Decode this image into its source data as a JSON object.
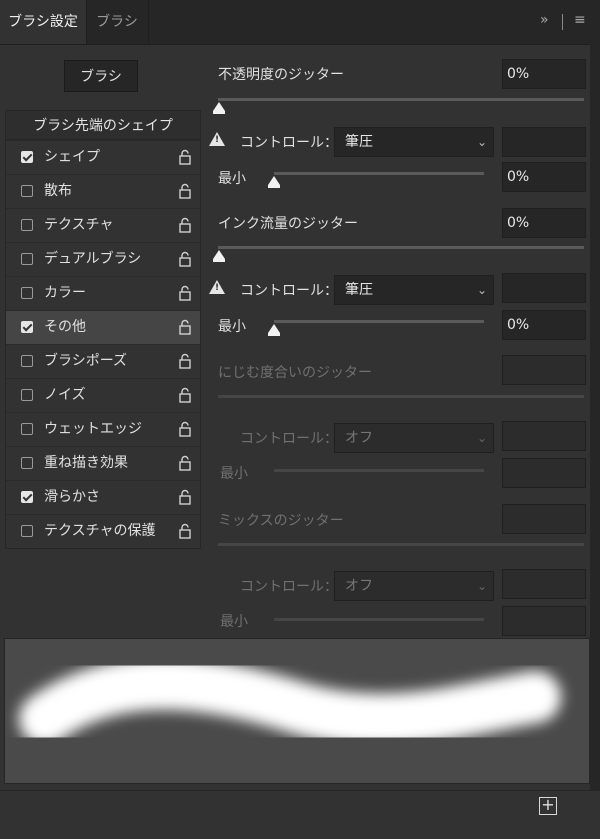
{
  "tabs": {
    "active": "ブラシ設定",
    "inactive": "ブラシ"
  },
  "brushes_button": "ブラシ",
  "tip_shape_label": "ブラシ先端のシェイプ",
  "options": [
    {
      "label": "シェイプ",
      "checked": true
    },
    {
      "label": "散布",
      "checked": false
    },
    {
      "label": "テクスチャ",
      "checked": false
    },
    {
      "label": "デュアルブラシ",
      "checked": false
    },
    {
      "label": "カラー",
      "checked": false
    },
    {
      "label": "その他",
      "checked": true,
      "selected": true
    },
    {
      "label": "ブラシポーズ",
      "checked": false
    },
    {
      "label": "ノイズ",
      "checked": false
    },
    {
      "label": "ウェットエッジ",
      "checked": false
    },
    {
      "label": "重ね描き効果",
      "checked": false
    },
    {
      "label": "滑らかさ",
      "checked": true
    },
    {
      "label": "テクスチャの保護",
      "checked": false
    }
  ],
  "opacity_jitter": {
    "label": "不透明度のジッター",
    "value": "0%",
    "control_label": "コントロール：",
    "control": "筆圧",
    "min_label": "最小",
    "min_value": "0%"
  },
  "flow_jitter": {
    "label": "インク流量のジッター",
    "value": "0%",
    "control_label": "コントロール：",
    "control": "筆圧",
    "min_label": "最小",
    "min_value": "0%"
  },
  "wetness_jitter": {
    "label": "にじむ度合いのジッター",
    "control_label": "コントロール：",
    "control": "オフ",
    "min_label": "最小"
  },
  "mix_jitter": {
    "label": "ミックスのジッター",
    "control_label": "コントロール：",
    "control": "オフ",
    "min_label": "最小"
  },
  "icons": {
    "expand": "double-chevron-icon",
    "menu": "hamburger-menu-icon",
    "lock": "lock-icon",
    "warning": "warning-icon",
    "new": "new-preset-icon"
  }
}
